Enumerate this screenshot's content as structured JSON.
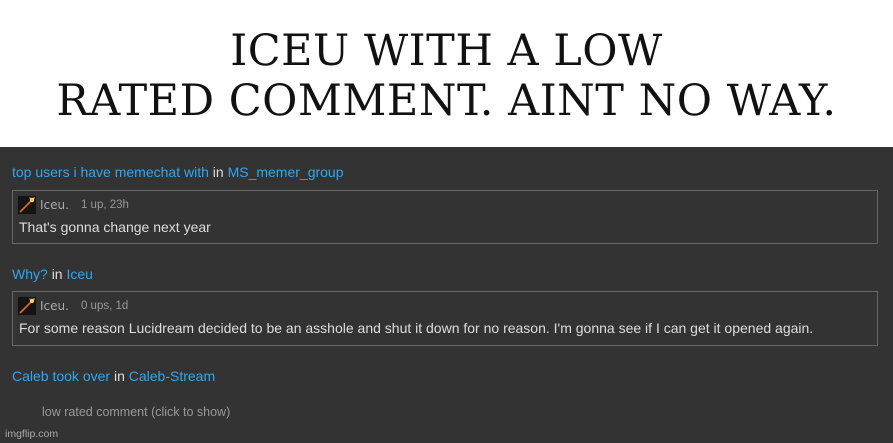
{
  "caption": {
    "line1": "ICEU WITH A LOW",
    "line2": "RATED COMMENT. AINT NO WAY."
  },
  "colors": {
    "link": "#2fa7ef",
    "panel_bg": "#333333",
    "text": "#dddddd"
  },
  "entries": [
    {
      "title": "top users i have memechat with",
      "in_word": "in",
      "stream": "MS_memer_group",
      "comment": {
        "avatar_icon": "sparkler-avatar-icon",
        "username": "Iceu.",
        "votes_time": "1 up, 23h",
        "text": "That's gonna change next year"
      }
    },
    {
      "title": "Why?",
      "in_word": "in",
      "stream": "Iceu",
      "comment": {
        "avatar_icon": "sparkler-avatar-icon",
        "username": "Iceu.",
        "votes_time": "0 ups, 1d",
        "text": "For some reason Lucidream decided to be an asshole and shut it down for no reason. I'm gonna see if I can get it opened again."
      }
    },
    {
      "title": "Caleb took over",
      "in_word": "in",
      "stream": "Caleb-Stream",
      "low_rated_text": "low rated comment (click to show)"
    }
  ],
  "watermark": "imgflip.com"
}
